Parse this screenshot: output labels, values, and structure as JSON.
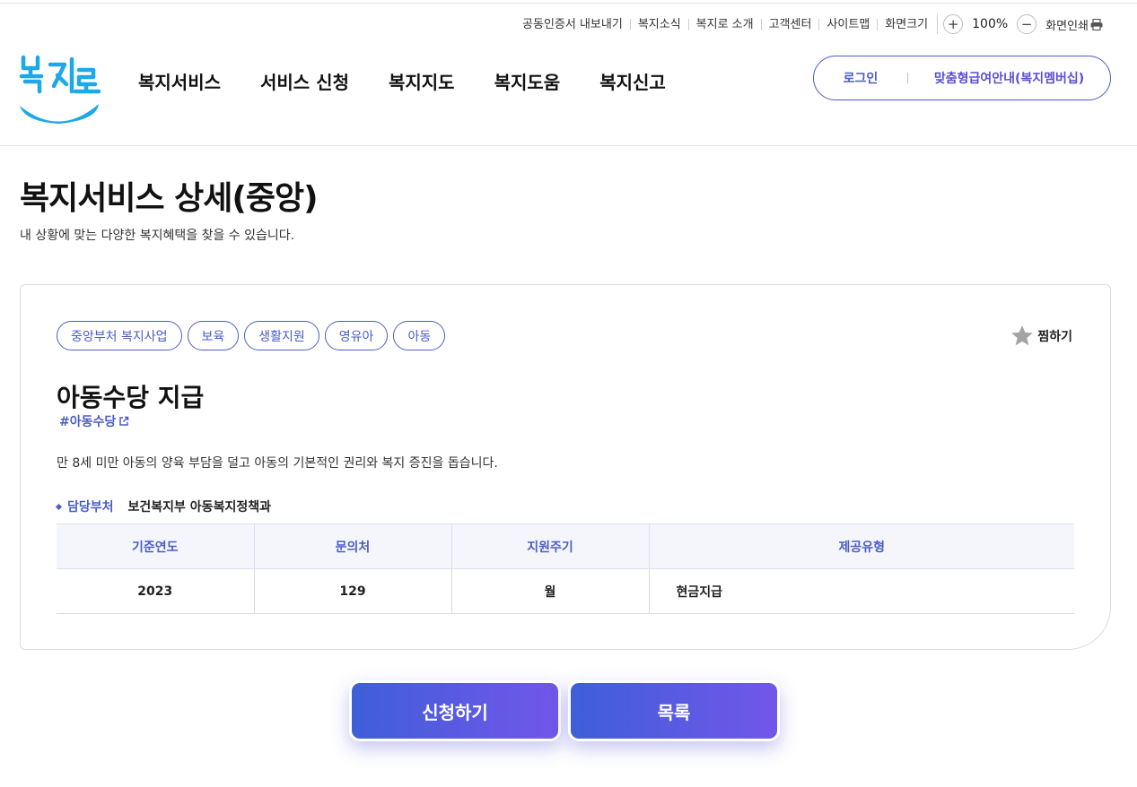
{
  "utility": {
    "cert_export": "공동인증서 내보내기",
    "news": "복지소식",
    "about": "복지로 소개",
    "customer_center": "고객센터",
    "sitemap": "사이트맵",
    "screen_size": "화면크기",
    "zoom_value": "100%",
    "zoom_in": "+",
    "zoom_out": "−",
    "print": "화면인쇄"
  },
  "header": {
    "logo_text": "복지로",
    "nav": [
      "복지서비스",
      "서비스 신청",
      "복지지도",
      "복지도움",
      "복지신고"
    ],
    "login": "로그인",
    "membership": "맞춤형급여안내(복지멤버십)"
  },
  "page": {
    "title": "복지서비스 상세(중앙)",
    "description": "내 상황에 맞는 다양한 복지혜택을 찾을 수 있습니다."
  },
  "service": {
    "tags": [
      "중앙부처 복지사업",
      "보육",
      "생활지원",
      "영유아",
      "아동"
    ],
    "favorite": "찜하기",
    "title": "아동수당 지급",
    "hashtag": "#아동수당",
    "description": "만 8세 미만 아동의 양육 부담을 덜고 아동의 기본적인 권리와 복지 증진을 돕습니다.",
    "department_label": "담당부처",
    "department_value": "보건복지부 아동복지정책과",
    "table": {
      "headers": [
        "기준연도",
        "문의처",
        "지원주기",
        "제공유형"
      ],
      "row": [
        "2023",
        "129",
        "월",
        "현금지급"
      ]
    }
  },
  "actions": {
    "apply": "신청하기",
    "list": "목록"
  },
  "colors": {
    "accent": "#4b5dc7",
    "button_gradient_start": "#3e5fd8",
    "button_gradient_end": "#7356ea",
    "logo_blue": "#1fa8e8"
  }
}
